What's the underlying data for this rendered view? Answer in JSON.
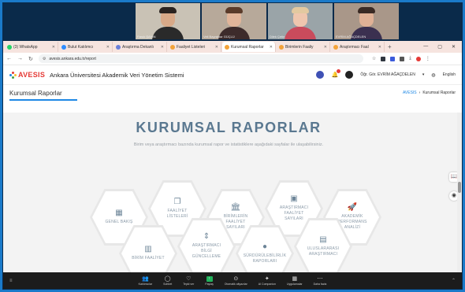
{
  "participants": [
    {
      "name": "Faruk ŞAHİN",
      "bg": "#c9c2b5",
      "skin": "#d8a988",
      "shirt": "#2a2a2a",
      "hair": "#2a2320"
    },
    {
      "name": "Veli Bayraktar GÜÇLÜ",
      "bg": "#b7a99a",
      "skin": "#e1b59a",
      "shirt": "#3d2b2b",
      "hair": "#5a3b2a"
    },
    {
      "name": "Dilek Çetin",
      "bg": "#9aa4a8",
      "skin": "#efc6ae",
      "shirt": "#c94b5c",
      "hair": "#e3c9a0"
    },
    {
      "name": "EVRİM AĞAÇDELEN",
      "bg": "#a99789",
      "skin": "#e0b196",
      "shirt": "#3b3050",
      "hair": "#3a2a24"
    }
  ],
  "browser": {
    "tabs": [
      {
        "label": "(3) WhatsApp",
        "color": "#25d366"
      },
      {
        "label": "Bulut Katılımcı",
        "color": "#2d8cff"
      },
      {
        "label": "Araştırma Dekanlı",
        "color": "#6a7fd9"
      },
      {
        "label": "Faaliyet Listeleri",
        "color": "#f3a33a"
      },
      {
        "label": "Kurumsal Raporlar",
        "color": "#f3a33a"
      },
      {
        "label": "Birimlerin Faaliy",
        "color": "#f3a33a"
      },
      {
        "label": "Araştırmacı Faal",
        "color": "#f3a33a"
      }
    ],
    "active_tab": 4,
    "url": "avesis.ankara.edu.tr/report"
  },
  "site": {
    "logo": "AVESIS",
    "title": "Ankara Üniversitesi Akademik Veri Yönetim Sistemi",
    "user": "Öğr. Gör. EVRİM AĞAÇDELEN",
    "language": "English",
    "page_title": "Kurumsal Raporlar",
    "breadcrumb_home": "AVESIS",
    "breadcrumb_current": "Kurumsal Raporlar"
  },
  "main": {
    "heading": "KURUMSAL RAPORLAR",
    "subheading": "Birim veya araştırmacı bazında kurumsal rapor ve istatistiklere aşağıdaki sayfalar ile ulaşabilirsiniz.",
    "cards": [
      {
        "label": "GENEL BAKIŞ",
        "icon": "▦"
      },
      {
        "label": "FAALİYET LİSTELERİ",
        "icon": "❐"
      },
      {
        "label": "BİRİMLERİN FAALİYET SAYILARI",
        "icon": "🏛"
      },
      {
        "label": "ARAŞTIRMACI FAALİYET SAYILARI",
        "icon": "▣"
      },
      {
        "label": "AKADEMİK PERFORMANS ANALİZİ",
        "icon": "🚀"
      },
      {
        "label": "BİRİM FAALİYET",
        "icon": "▥"
      },
      {
        "label": "ARAŞTIRMACI BİLGİ GÜNCELLEME",
        "icon": "⇕"
      },
      {
        "label": "SÜRDÜRÜLEBİLİRLİK RAPORLARI",
        "icon": "●"
      },
      {
        "label": "ULUSLARARASI ARAŞTIRMACI",
        "icon": "▤"
      }
    ]
  },
  "meeting_toolbar": [
    {
      "label": "Katılımcılar",
      "icon": "👥"
    },
    {
      "label": "Sohbet",
      "icon": "◯"
    },
    {
      "label": "Tepki ver",
      "icon": "♡"
    },
    {
      "label": "Paylaş",
      "icon": "↑"
    },
    {
      "label": "Otomatik altyazılar",
      "icon": "⊙"
    },
    {
      "label": "AI Companion",
      "icon": "✦"
    },
    {
      "label": "Uygulamalar",
      "icon": "▦"
    },
    {
      "label": "Daha fazla",
      "icon": "⋯"
    }
  ]
}
